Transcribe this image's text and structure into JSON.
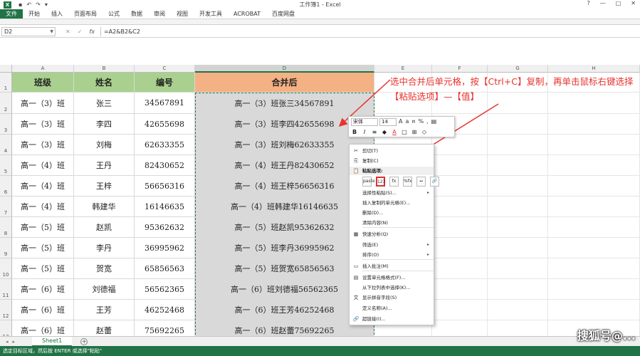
{
  "window": {
    "title": "工作簿1 - Excel",
    "app_icon": "X",
    "quick_access": [
      "save-icon",
      "undo-icon",
      "redo-icon",
      "customize-icon"
    ],
    "controls": [
      "?",
      "—",
      "□",
      "✕"
    ]
  },
  "ribbon": {
    "tabs": [
      "文件",
      "开始",
      "插入",
      "页面布局",
      "公式",
      "数据",
      "审阅",
      "视图",
      "开发工具",
      "ACROBAT",
      "百度网盘"
    ]
  },
  "formula_bar": {
    "name_box": "D2",
    "cancel": "✕",
    "enter": "✓",
    "fx": "fx",
    "formula": "=A2&B2&C2"
  },
  "columns": [
    "A",
    "B",
    "C",
    "D",
    "E",
    "F",
    "G",
    "H"
  ],
  "rows": [
    "1",
    "2",
    "3",
    "4",
    "5",
    "6",
    "7",
    "8",
    "9",
    "10",
    "11",
    "12",
    "13"
  ],
  "table": {
    "headers": [
      "班级",
      "姓名",
      "编号",
      "合并后"
    ],
    "rows": [
      [
        "高一（3）班",
        "张三",
        "34567891",
        "高一（3）班张三34567891"
      ],
      [
        "高一（3）班",
        "李四",
        "42655698",
        "高一（3）班李四42655698"
      ],
      [
        "高一（3）班",
        "刘梅",
        "62633355",
        "高一（3）班刘梅62633355"
      ],
      [
        "高一（4）班",
        "王丹",
        "82430652",
        "高一（4）班王丹82430652"
      ],
      [
        "高一（4）班",
        "王梓",
        "56656316",
        "高一（4）班王梓56656316"
      ],
      [
        "高一（4）班",
        "韩建华",
        "16146635",
        "高一（4）班韩建华16146635"
      ],
      [
        "高一（5）班",
        "赵凯",
        "95362632",
        "高一（5）班赵凯95362632"
      ],
      [
        "高一（5）班",
        "李丹",
        "36995962",
        "高一（5）班李丹36995962"
      ],
      [
        "高一（5）班",
        "贺宽",
        "65856563",
        "高一（5）班贺宽65856563"
      ],
      [
        "高一（6）班",
        "刘德福",
        "56562365",
        "高一（6）班刘德福56562365"
      ],
      [
        "高一（6）班",
        "王芳",
        "46252468",
        "高一（6）班王芳46252468"
      ],
      [
        "高一（6）班",
        "赵蕾",
        "75692265",
        "高一（6）班赵蕾75692265"
      ]
    ]
  },
  "mini_toolbar": {
    "font": "宋体",
    "size": "14",
    "buttons": [
      "B",
      "I",
      "≡",
      "A",
      "%",
      ","
    ]
  },
  "context_menu": {
    "items": [
      {
        "label": "剪切(T)",
        "icon": "scissors-icon",
        "glyph": "✂"
      },
      {
        "label": "复制(C)",
        "icon": "copy-icon",
        "glyph": "⎘"
      },
      {
        "label": "粘贴选项:",
        "icon": "paste-icon",
        "glyph": "📋",
        "section": true
      },
      {
        "label": "选择性粘贴(S)...",
        "sub": "▸"
      },
      {
        "label": "插入复制的单元格(E)..."
      },
      {
        "label": "删除(D)..."
      },
      {
        "label": "清除内容(N)"
      },
      {
        "label": "快速分析(Q)",
        "icon": "quick-analysis-icon",
        "glyph": "▦"
      },
      {
        "label": "筛选(E)",
        "sub": "▸"
      },
      {
        "label": "排序(O)",
        "sub": "▸"
      },
      {
        "label": "插入批注(M)",
        "icon": "comment-icon",
        "glyph": "▭"
      },
      {
        "label": "设置单元格格式(F)...",
        "icon": "format-cells-icon",
        "glyph": "▤"
      },
      {
        "label": "从下拉列表中选择(K)..."
      },
      {
        "label": "显示拼音字段(S)",
        "icon": "phonetic-icon",
        "glyph": "文"
      },
      {
        "label": "定义名称(A)..."
      },
      {
        "label": "超链接(I)...",
        "icon": "hyperlink-icon",
        "glyph": "🔗"
      }
    ],
    "paste_options": [
      "paste",
      "123",
      "fx",
      "%fx",
      "↔",
      "🔗"
    ]
  },
  "annotation": {
    "text": "选中合并后单元格，按【Ctrl+C】复制，再单击鼠标右键选择【粘贴选项】—【值】",
    "color": "#e8332d"
  },
  "sheets": {
    "tabs": [
      "Sheet1"
    ],
    "add": "+"
  },
  "status": {
    "text": "选定目标区域，然后按 ENTER 或选择\"粘贴\""
  },
  "watermark": "搜狐号@..."
}
